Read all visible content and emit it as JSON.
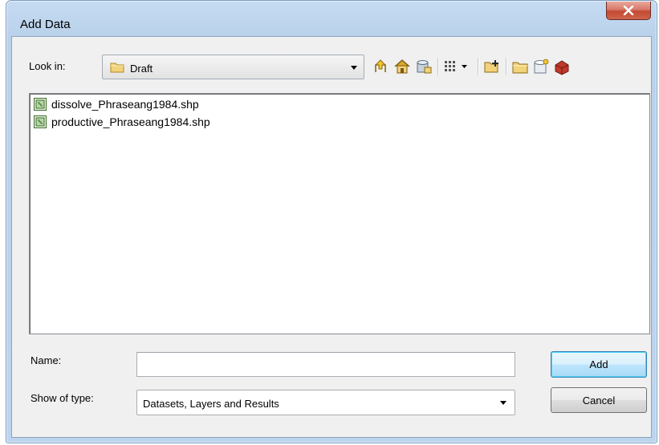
{
  "window": {
    "title": "Add Data"
  },
  "toolbar": {
    "look_in_label": "Look in:",
    "look_in_value": "Draft",
    "buttons": [
      {
        "name": "up-one-level",
        "icon": "folder-up-icon"
      },
      {
        "name": "go-home",
        "icon": "home-icon"
      },
      {
        "name": "connect",
        "icon": "database-connect-icon"
      },
      {
        "name": "view-options",
        "icon": "list-view-icon"
      },
      {
        "name": "add-connection",
        "icon": "add-folder-connection-icon"
      },
      {
        "name": "new-folder",
        "icon": "new-folder-icon"
      },
      {
        "name": "new-geodatabase",
        "icon": "new-geodatabase-icon"
      },
      {
        "name": "toolbox",
        "icon": "toolbox-icon"
      }
    ]
  },
  "files": [
    {
      "name": "dissolve_Phraseang1984.shp",
      "icon": "shapefile-polygon-icon"
    },
    {
      "name": "productive_Phraseang1984.shp",
      "icon": "shapefile-polygon-icon"
    }
  ],
  "form": {
    "name_label": "Name:",
    "name_value": "",
    "type_label": "Show of type:",
    "type_value": "Datasets, Layers and Results"
  },
  "actions": {
    "add_label": "Add",
    "cancel_label": "Cancel"
  },
  "colors": {
    "accent": "#3c7fb1",
    "close": "#c24a33",
    "folder": "#f2d27a"
  }
}
